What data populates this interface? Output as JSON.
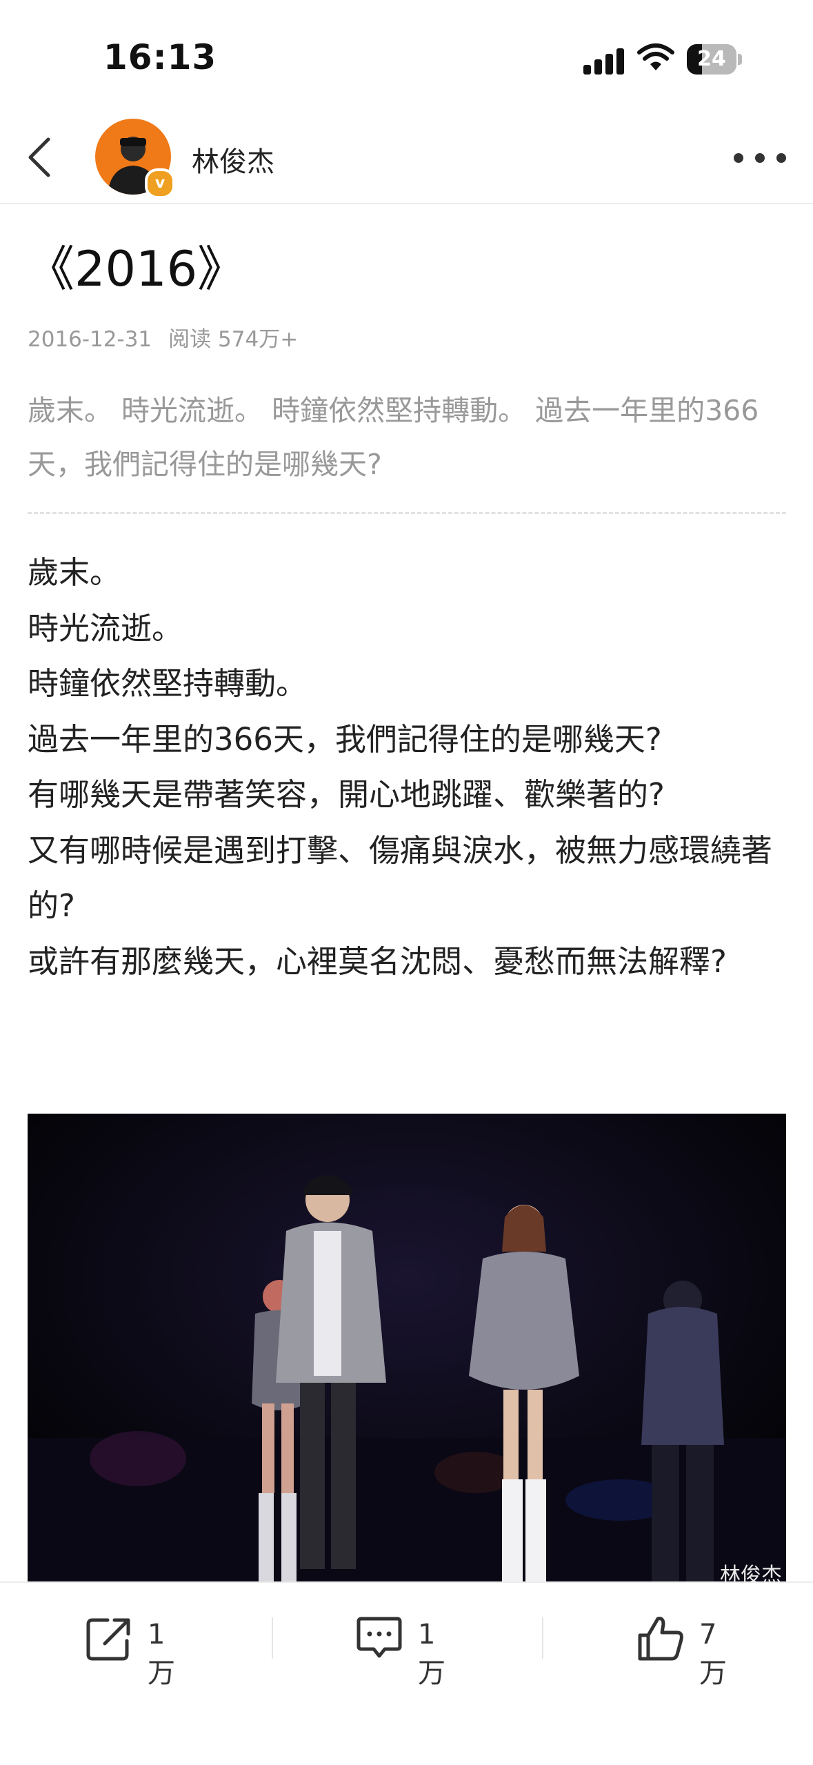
{
  "status_bar": {
    "time": "16:13",
    "battery": "24"
  },
  "nav": {
    "username": "林俊杰"
  },
  "article": {
    "title": "《2016》",
    "date": "2016-12-31",
    "reads": "阅读 574万+",
    "summary": "歲末。 時光流逝。 時鐘依然堅持轉動。 過去一年里的366天，我們記得住的是哪幾天?",
    "body": [
      "歲末。",
      "時光流逝。",
      "時鐘依然堅持轉動。",
      "過去一年里的366天，我們記得住的是哪幾天?",
      "有哪幾天是帶著笑容，開心地跳躍、歡樂著的?",
      "又有哪時候是遇到打擊、傷痛與淚水，被無力感環繞著的?",
      "或許有那麼幾天，心裡莫名沈悶、憂愁而無法解釋?"
    ],
    "watermark": "林俊杰"
  },
  "actions": {
    "share_count": "1万",
    "comment_count": "1万",
    "like_count": "7万"
  }
}
